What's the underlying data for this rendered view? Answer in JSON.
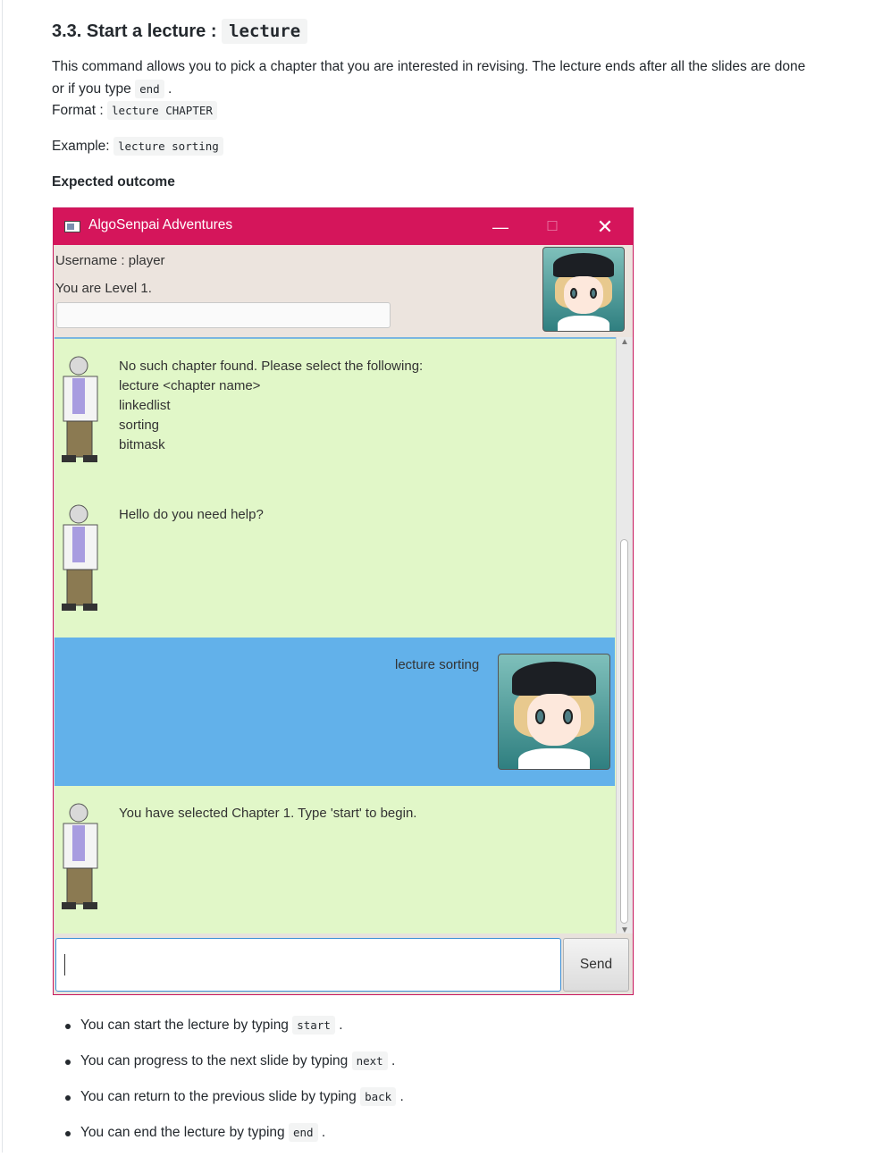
{
  "section": {
    "heading": "3.3. Start a lecture :",
    "heading_code": "lecture"
  },
  "description": {
    "line1": "This command allows you to pick a chapter that you are interested in revising. The lecture ends after all the slides are done",
    "line2_prefix": "or if you type",
    "line2_code": "end",
    "line2_suffix": ".",
    "format_label": "Format :",
    "format_code": "lecture CHAPTER",
    "example_label": "Example:",
    "example_code": "lecture sorting",
    "expected": "Expected outcome"
  },
  "app": {
    "title": "AlgoSenpai Adventures",
    "minimize": "—",
    "maximize": "☐",
    "close": "✕",
    "username": "Username : player",
    "level": "You are Level 1.",
    "messages": [
      {
        "from": "bot",
        "lines": [
          "No such chapter found. Please select the following:",
          "lecture <chapter name>",
          "linkedlist",
          "sorting",
          "bitmask"
        ]
      },
      {
        "from": "bot",
        "lines": [
          "Hello do you need help?"
        ]
      },
      {
        "from": "user",
        "lines": [
          "lecture sorting"
        ]
      },
      {
        "from": "bot",
        "lines": [
          "You have selected Chapter 1. Type 'start' to begin."
        ]
      }
    ],
    "input_value": "",
    "send_label": "Send"
  },
  "tips": [
    {
      "text": "You can start the lecture by typing",
      "code": "start"
    },
    {
      "text": "You can progress to the next slide by typing",
      "code": "next"
    },
    {
      "text": "You can return to the previous slide by typing",
      "code": "back"
    },
    {
      "text": "You can end the lecture by typing",
      "code": "end"
    }
  ]
}
